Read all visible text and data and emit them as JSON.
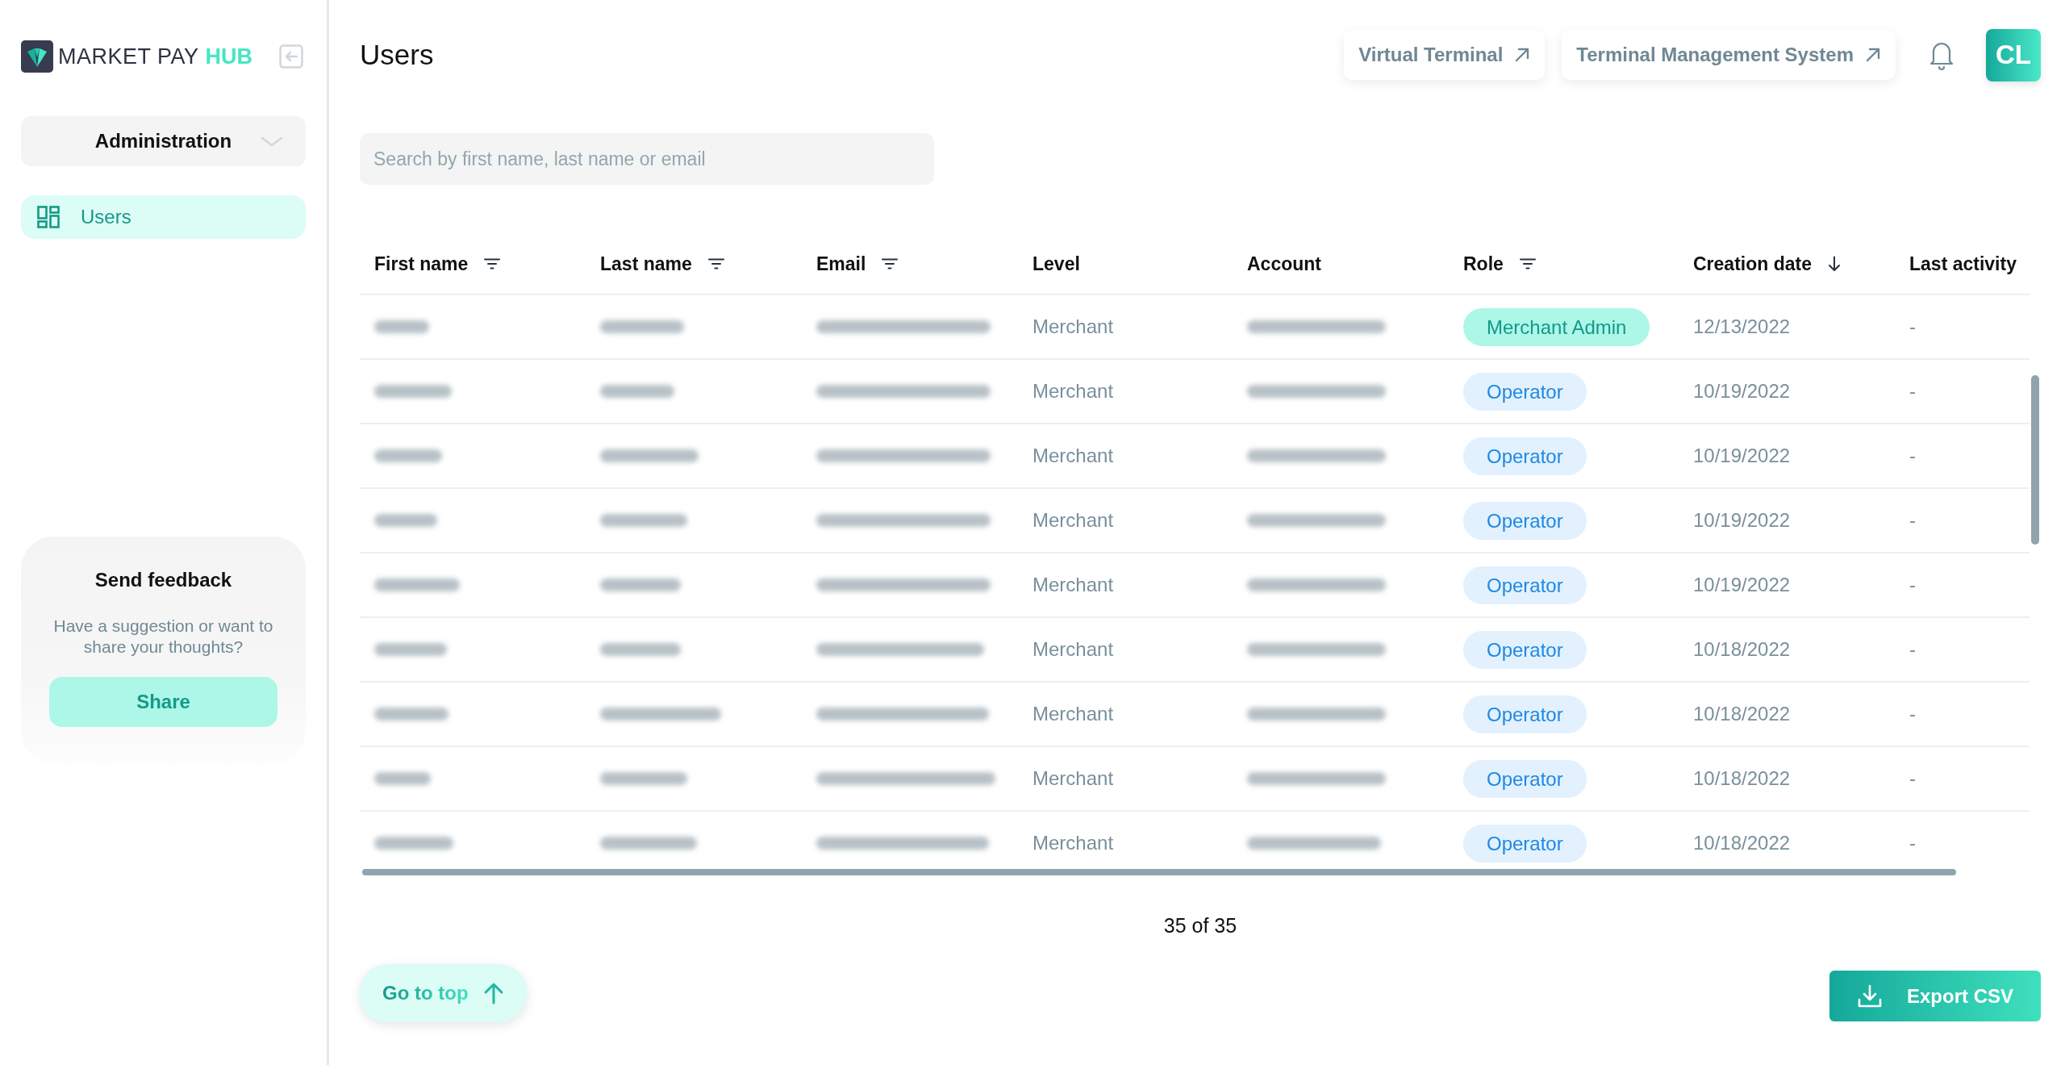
{
  "sidebar": {
    "logo": {
      "name": "MARKET PAY",
      "accent": "HUB"
    },
    "section": {
      "label": "Administration"
    },
    "items": [
      {
        "label": "Users",
        "selected": true
      }
    ],
    "feedback": {
      "title": "Send feedback",
      "text": "Have a suggestion or want to share your thoughts?",
      "button": "Share"
    }
  },
  "header": {
    "title": "Users",
    "links": [
      "Virtual Terminal",
      "Terminal Management System"
    ],
    "avatar": "CL"
  },
  "search": {
    "placeholder": "Search by first name, last name or email"
  },
  "table": {
    "columns": [
      {
        "label": "First name",
        "kind": "filter"
      },
      {
        "label": "Last name",
        "kind": "filter"
      },
      {
        "label": "Email",
        "kind": "filter"
      },
      {
        "label": "Level",
        "kind": "plain"
      },
      {
        "label": "Account",
        "kind": "plain"
      },
      {
        "label": "Role",
        "kind": "filter"
      },
      {
        "label": "Creation date",
        "kind": "sort"
      },
      {
        "label": "Last activity",
        "kind": "plain"
      }
    ],
    "rows": [
      {
        "level": "Merchant",
        "role": {
          "label": "Merchant Admin",
          "kind": "admin"
        },
        "created": "12/13/2022",
        "last_activity": "-"
      },
      {
        "level": "Merchant",
        "role": {
          "label": "Operator",
          "kind": "operator"
        },
        "created": "10/19/2022",
        "last_activity": "-"
      },
      {
        "level": "Merchant",
        "role": {
          "label": "Operator",
          "kind": "operator"
        },
        "created": "10/19/2022",
        "last_activity": "-"
      },
      {
        "level": "Merchant",
        "role": {
          "label": "Operator",
          "kind": "operator"
        },
        "created": "10/19/2022",
        "last_activity": "-"
      },
      {
        "level": "Merchant",
        "role": {
          "label": "Operator",
          "kind": "operator"
        },
        "created": "10/19/2022",
        "last_activity": "-"
      },
      {
        "level": "Merchant",
        "role": {
          "label": "Operator",
          "kind": "operator"
        },
        "created": "10/18/2022",
        "last_activity": "-"
      },
      {
        "level": "Merchant",
        "role": {
          "label": "Operator",
          "kind": "operator"
        },
        "created": "10/18/2022",
        "last_activity": "-"
      },
      {
        "level": "Merchant",
        "role": {
          "label": "Operator",
          "kind": "operator"
        },
        "created": "10/18/2022",
        "last_activity": "-"
      },
      {
        "level": "Merchant",
        "role": {
          "label": "Operator",
          "kind": "operator"
        },
        "created": "10/18/2022",
        "last_activity": "-"
      }
    ]
  },
  "pagination": "35 of 35",
  "footer": {
    "go_top": "Go to top",
    "export": "Export CSV"
  }
}
